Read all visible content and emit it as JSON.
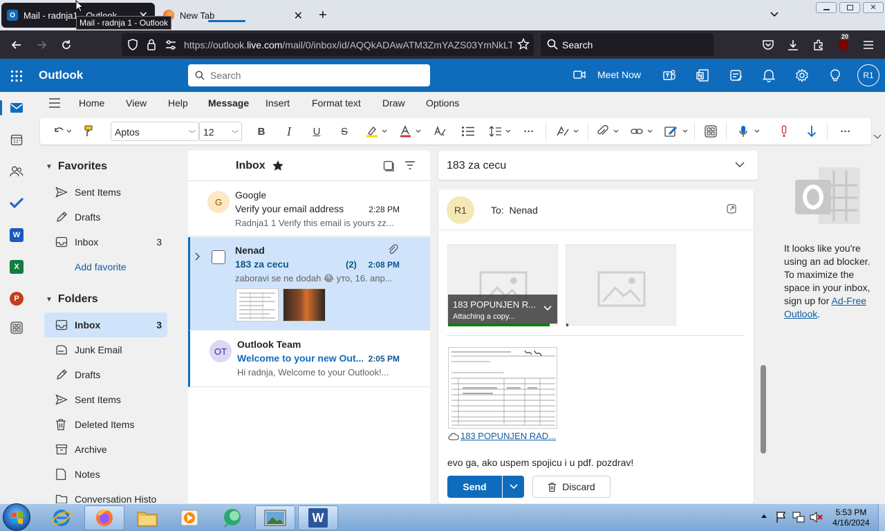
{
  "browser": {
    "tabs": [
      {
        "title": "Mail - radnja1 - Outlook"
      },
      {
        "title": "New Tab"
      }
    ],
    "tooltip": "Mail - radnja 1 - Outlook",
    "url_prefix": "https://outlook.",
    "url_domain": "live.com",
    "url_suffix": "/mail/0/inbox/id/AQQkADAwATM3ZmYAZS03YmNkLT",
    "search_placeholder": "Search",
    "extension_badge": "20"
  },
  "outlook": {
    "app_name": "Outlook",
    "search_placeholder": "Search",
    "meet_now": "Meet Now",
    "user_initials": "R1"
  },
  "ribbon": {
    "tabs": [
      "Home",
      "View",
      "Help",
      "Message",
      "Insert",
      "Format text",
      "Draw",
      "Options"
    ],
    "active_tab": "Message",
    "font_name": "Aptos",
    "font_size": "12"
  },
  "folders": {
    "favorites_label": "Favorites",
    "favorites": [
      {
        "label": "Sent Items",
        "icon": "send-icon",
        "count": ""
      },
      {
        "label": "Drafts",
        "icon": "pencil-icon",
        "count": ""
      },
      {
        "label": "Inbox",
        "icon": "inbox-icon",
        "count": "3"
      }
    ],
    "add_favorite": "Add favorite",
    "folders_label": "Folders",
    "items": [
      {
        "label": "Inbox",
        "icon": "inbox-icon",
        "count": "3",
        "selected": true
      },
      {
        "label": "Junk Email",
        "icon": "junk-icon",
        "count": ""
      },
      {
        "label": "Drafts",
        "icon": "pencil-icon",
        "count": ""
      },
      {
        "label": "Sent Items",
        "icon": "send-icon",
        "count": ""
      },
      {
        "label": "Deleted Items",
        "icon": "trash-icon",
        "count": ""
      },
      {
        "label": "Archive",
        "icon": "archive-icon",
        "count": ""
      },
      {
        "label": "Notes",
        "icon": "notes-icon",
        "count": ""
      },
      {
        "label": "Conversation Histo",
        "icon": "folder-icon",
        "count": ""
      }
    ]
  },
  "message_list": {
    "title": "Inbox",
    "messages": [
      {
        "initial": "G",
        "sender": "Google",
        "subject": "Verify your email address",
        "time": "2:28 PM",
        "preview": "Radnja1 1 Verify this email is yours zz..."
      },
      {
        "sender": "Nenad",
        "subject": "183 za cecu",
        "count": "(2)",
        "time": "2:08 PM",
        "preview": "zaboravi se ne dodah 😂 уто, 16. апр..."
      },
      {
        "initial": "OT",
        "sender": "Outlook Team",
        "subject": "Welcome to your new Out...",
        "time": "2:05 PM",
        "preview": "Hi radnja, Welcome to your Outlook!..."
      }
    ]
  },
  "reading_pane": {
    "subject": "183 za cecu",
    "from_initials": "R1",
    "to_label": "To:",
    "to_name": "Nenad",
    "attachment1_name": "183 POPUNJEN R...",
    "attachment1_status": "Attaching a copy...",
    "attachment1_progress": 0.93,
    "attachment2_progress": 0.02,
    "doc_link": "183 POPUNJEN RAD...",
    "body": "evo ga, ako uspem spojicu i u pdf. pozdrav!",
    "send_label": "Send",
    "discard_label": "Discard"
  },
  "ad_panel": {
    "text": "It looks like you're using an ad blocker. To maximize the space in your inbox, sign up for ",
    "link": "Ad-Free Outlook",
    "end": "."
  },
  "taskbar": {
    "time": "5:53 PM",
    "date": "4/16/2024"
  },
  "colors": {
    "outlook_blue": "#0f6cbd",
    "selection": "#cfe4fa"
  }
}
